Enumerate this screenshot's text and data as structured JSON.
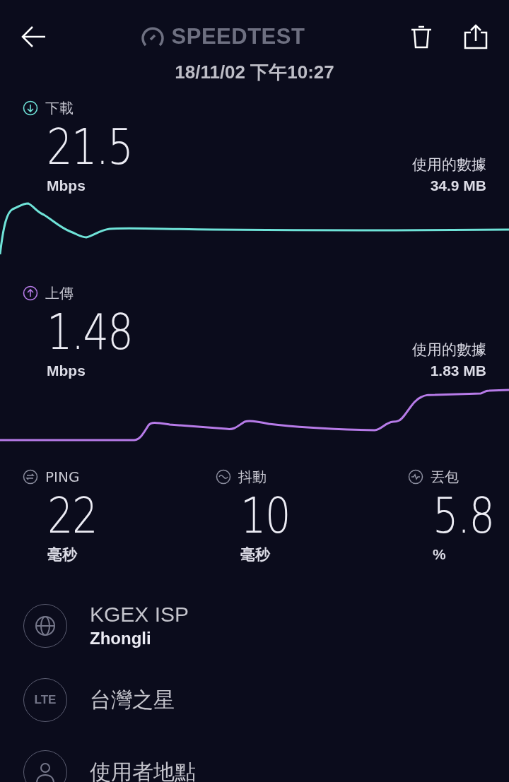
{
  "header": {
    "title": "SPEEDTEST",
    "timestamp": "18/11/02 下午10:27"
  },
  "results": [
    {
      "kind": "download",
      "label": "下載",
      "value": "21.5",
      "unit": "Mbps",
      "data_label": "使用的數據",
      "data_value": "34.9 MB",
      "color": "#6fe3d8"
    },
    {
      "kind": "upload",
      "label": "上傳",
      "value": "1.48",
      "unit": "Mbps",
      "data_label": "使用的數據",
      "data_value": "1.83 MB",
      "color": "#b77be8"
    }
  ],
  "metrics": [
    {
      "kind": "ping",
      "label": "PING",
      "value": "22",
      "unit": "毫秒"
    },
    {
      "kind": "jitter",
      "label": "抖動",
      "value": "10",
      "unit": "毫秒"
    },
    {
      "kind": "loss",
      "label": "丟包",
      "value": "5.8",
      "unit": "%"
    }
  ],
  "info": [
    {
      "kind": "server",
      "title": "KGEX ISP",
      "subtitle": "Zhongli"
    },
    {
      "kind": "carrier",
      "badge": "LTE",
      "title": "台灣之星"
    },
    {
      "kind": "user",
      "title": "使用者地點"
    }
  ]
}
